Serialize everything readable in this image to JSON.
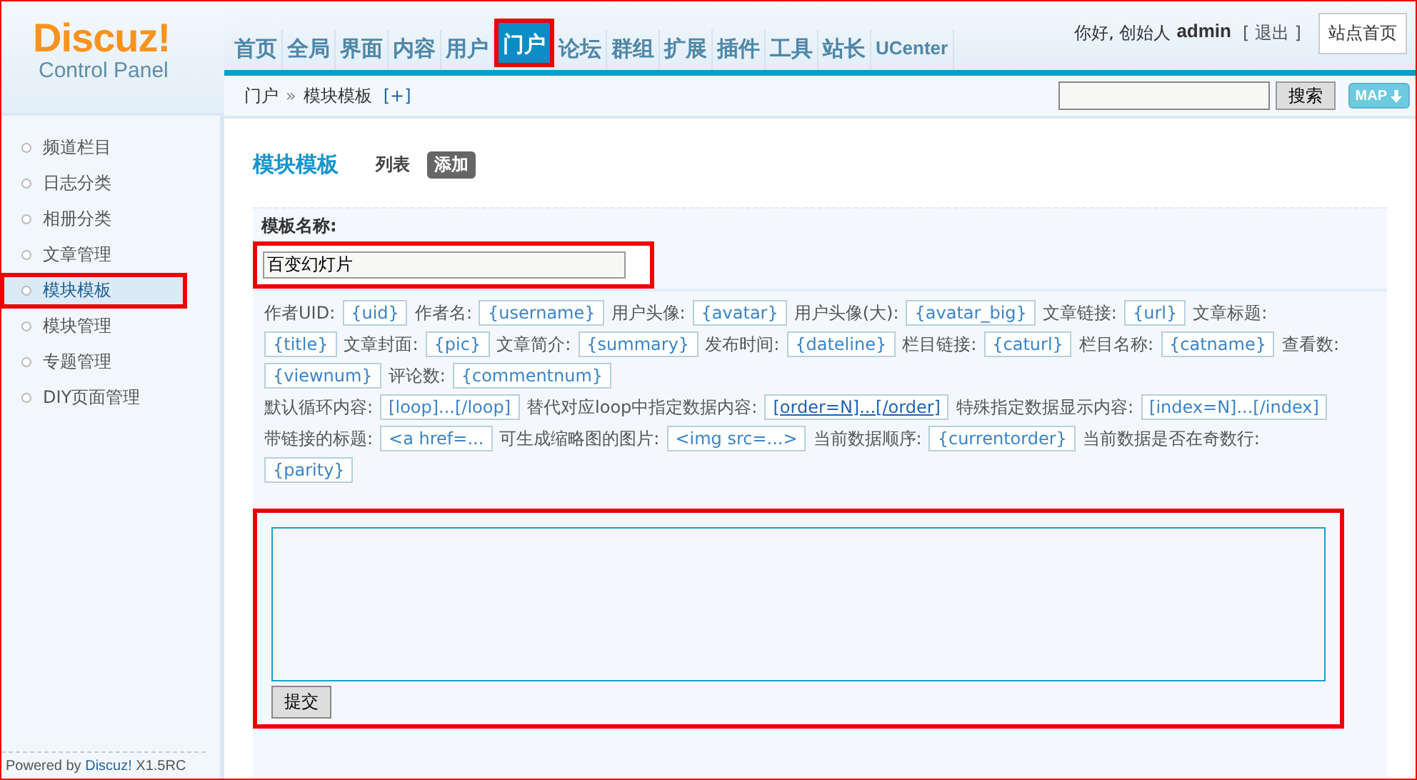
{
  "logo": {
    "name": "Discuz!",
    "subtitle": "Control Panel"
  },
  "nav": [
    {
      "label": "首页",
      "selected": false
    },
    {
      "label": "全局",
      "selected": false
    },
    {
      "label": "界面",
      "selected": false
    },
    {
      "label": "内容",
      "selected": false
    },
    {
      "label": "用户",
      "selected": false
    },
    {
      "label": "门户",
      "selected": true
    },
    {
      "label": "论坛",
      "selected": false
    },
    {
      "label": "群组",
      "selected": false
    },
    {
      "label": "扩展",
      "selected": false
    },
    {
      "label": "插件",
      "selected": false
    },
    {
      "label": "工具",
      "selected": false
    },
    {
      "label": "站长",
      "selected": false
    },
    {
      "label": "UCenter",
      "selected": false
    }
  ],
  "user": {
    "greeting": "你好, 创始人",
    "name": "admin",
    "logout": "[ 退出 ]",
    "home": "站点首页"
  },
  "breadcrumb": {
    "section": "门户",
    "sep": "»",
    "page": "模块模板",
    "add": "[+]"
  },
  "search": {
    "button": "搜索",
    "map": "MAP"
  },
  "sidebar": {
    "items": [
      {
        "label": "频道栏目",
        "selected": false
      },
      {
        "label": "日志分类",
        "selected": false
      },
      {
        "label": "相册分类",
        "selected": false
      },
      {
        "label": "文章管理",
        "selected": false
      },
      {
        "label": "模块模板",
        "selected": true
      },
      {
        "label": "模块管理",
        "selected": false
      },
      {
        "label": "专题管理",
        "selected": false
      },
      {
        "label": "DIY页面管理",
        "selected": false
      }
    ],
    "footer": {
      "prefix": "Powered by",
      "brand": "Discuz!",
      "version": "X1.5RC"
    }
  },
  "content": {
    "title": "模块模板",
    "tabs": [
      {
        "label": "列表",
        "selected": false
      },
      {
        "label": "添加",
        "selected": true
      }
    ],
    "name_label": "模板名称:",
    "name_value": "百变幻灯片",
    "name_highlighted": true,
    "token_rows": [
      [
        {
          "kind": "label",
          "text": "作者UID:"
        },
        {
          "kind": "token",
          "text": "{uid}"
        },
        {
          "kind": "label",
          "text": "作者名:"
        },
        {
          "kind": "token",
          "text": "{username}"
        },
        {
          "kind": "label",
          "text": "用户头像:"
        },
        {
          "kind": "token",
          "text": "{avatar}"
        },
        {
          "kind": "label",
          "text": "用户头像(大):"
        },
        {
          "kind": "token",
          "text": "{avatar_big}"
        },
        {
          "kind": "label",
          "text": "文章链接:"
        },
        {
          "kind": "token",
          "text": "{url}"
        },
        {
          "kind": "label",
          "text": "文章标题:"
        }
      ],
      [
        {
          "kind": "token",
          "text": "{title}"
        },
        {
          "kind": "label",
          "text": "文章封面:"
        },
        {
          "kind": "token",
          "text": "{pic}"
        },
        {
          "kind": "label",
          "text": "文章简介:"
        },
        {
          "kind": "token",
          "text": "{summary}"
        },
        {
          "kind": "label",
          "text": "发布时间:"
        },
        {
          "kind": "token",
          "text": "{dateline}"
        },
        {
          "kind": "label",
          "text": "栏目链接:"
        },
        {
          "kind": "token",
          "text": "{caturl}"
        },
        {
          "kind": "label",
          "text": "栏目名称:"
        },
        {
          "kind": "token",
          "text": "{catname}"
        },
        {
          "kind": "label",
          "text": "查看数:"
        }
      ],
      [
        {
          "kind": "token",
          "text": "{viewnum}"
        },
        {
          "kind": "label",
          "text": "评论数:"
        },
        {
          "kind": "token",
          "text": "{commentnum}"
        }
      ],
      [
        {
          "kind": "label",
          "text": "默认循环内容:"
        },
        {
          "kind": "token",
          "text": "[loop]...[/loop]"
        },
        {
          "kind": "label",
          "text": "替代对应loop中指定数据内容:"
        },
        {
          "kind": "link",
          "text": "[order=N]...[/order]"
        },
        {
          "kind": "label",
          "text": "特殊指定数据显示内容:"
        },
        {
          "kind": "token",
          "text": "[index=N]...[/index]"
        }
      ],
      [
        {
          "kind": "label",
          "text": "带链接的标题:"
        },
        {
          "kind": "token",
          "text": "<a href=..."
        },
        {
          "kind": "label",
          "text": "可生成缩略图的图片:"
        },
        {
          "kind": "token",
          "text": "<img src=...>"
        },
        {
          "kind": "label",
          "text": "当前数据顺序:"
        },
        {
          "kind": "token",
          "text": "{currentorder}"
        },
        {
          "kind": "label",
          "text": "当前数据是否在奇数行:"
        }
      ],
      [
        {
          "kind": "token",
          "text": "{parity}"
        }
      ]
    ],
    "editor_highlighted": true,
    "submit": "提交"
  }
}
